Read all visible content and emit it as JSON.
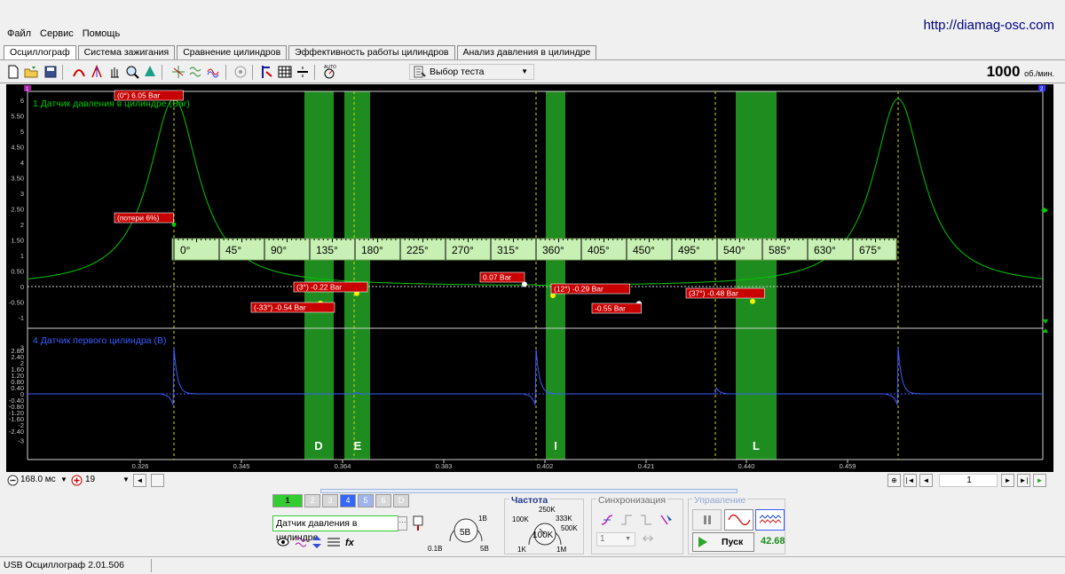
{
  "site_url": "http://diamag-osc.com",
  "menu": [
    "Файл",
    "Сервис",
    "Помощь"
  ],
  "tabs": [
    "Осциллограф",
    "Система зажигания",
    "Сравнение цилиндров",
    "Эффективность работы цилиндров",
    "Анализ давления в цилиндре"
  ],
  "toolbar": {
    "test_select": "Выбор теста",
    "rpm_value": "1000",
    "rpm_unit": "об./мин."
  },
  "plot": {
    "markers": {
      "top_left": "1",
      "top_right": "2"
    },
    "ch1_label": "1 Датчик давления в цилиндре (Bar)",
    "ch4_label": "4 Датчик первого цилиндра (В)",
    "ch1_ticks": [
      "6",
      "5.50",
      "5",
      "4.50",
      "4",
      "3.50",
      "3",
      "2.50",
      "2",
      "1.50",
      "1",
      "0.50",
      "0",
      "-0.50",
      "-1"
    ],
    "ch4_ticks": [
      "3",
      "2.80",
      "2.40",
      "2",
      "1.60",
      "1.20",
      "0.80",
      "0.40",
      "0",
      "-0.40",
      "-0.80",
      "-1.20",
      "-1.60",
      "-2",
      "-2.40",
      "-3"
    ],
    "x_ticks": [
      "0.326",
      "0.345",
      "0.364",
      "0.383",
      "0.402",
      "0.421",
      "0.440",
      "0.459"
    ],
    "angle_ticks": [
      "0°",
      "45°",
      "90°",
      "135°",
      "180°",
      "225°",
      "270°",
      "315°",
      "360°",
      "405°",
      "450°",
      "495°",
      "540°",
      "585°",
      "630°",
      "675°"
    ],
    "zones": [
      "D",
      "E",
      "I",
      "L"
    ],
    "annotations": {
      "peak": "(0°) 6.05 Bar",
      "loss": "(потери 6%)",
      "a_m33": "(-33°) -0.54 Bar",
      "a_3": "(3°) -0.22 Bar",
      "a_360": "0.07 Bar",
      "a_12": "(12°) -0.29 Bar",
      "a_min": "-0.55 Bar",
      "a_37": "(37°) -0.48 Bar"
    },
    "colors": {
      "pressure": "#00c800",
      "sensor": "#3a5cff",
      "zone": "#1e8c1e",
      "label_bg": "#c80000",
      "angle_band": "#c8f0b4"
    }
  },
  "scroll_row": {
    "time_base": "168.0 мс",
    "channel_select": "19",
    "page_number": "1"
  },
  "bottom": {
    "channels": [
      "1",
      "2",
      "3",
      "4",
      "5",
      "6",
      "D"
    ],
    "sensor_name": "Датчик давления в цилиндре",
    "voltage_knob": {
      "value": "5В",
      "min": "0.1В",
      "max": "5В",
      "mark": "1В"
    },
    "freq_title": "Частота",
    "freq_knob": {
      "value": "100K",
      "labels": [
        "250K",
        "100K",
        "333K",
        "500K",
        "1K",
        "1M"
      ]
    },
    "sync_title": "Синхронизация",
    "sync_value": "1",
    "control_title": "Управление",
    "start_label": "Пуск",
    "freq_reading": "42.68"
  },
  "status": {
    "app": "USB Осциллограф  2.01.506"
  }
}
